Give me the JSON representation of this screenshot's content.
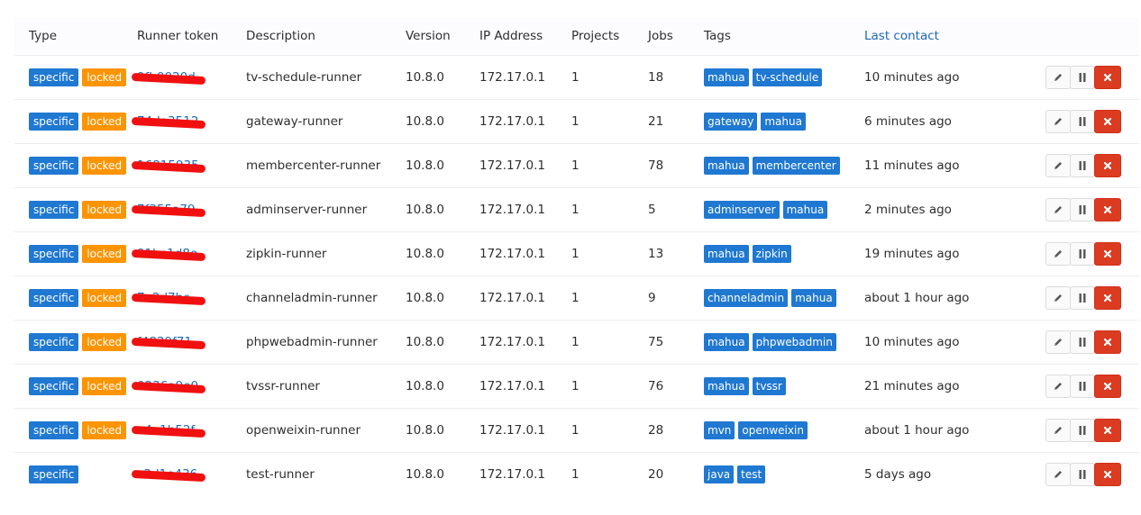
{
  "columns": {
    "type": "Type",
    "token": "Runner token",
    "description": "Description",
    "version": "Version",
    "ip": "IP Address",
    "projects": "Projects",
    "jobs": "Jobs",
    "tags": "Tags",
    "last_contact": "Last contact"
  },
  "runners": [
    {
      "specific": "specific",
      "locked": "locked",
      "token": "9fb0020d",
      "description": "tv-schedule-runner",
      "version": "10.8.0",
      "ip": "172.17.0.1",
      "projects": "1",
      "jobs": "18",
      "tags": [
        "mahua",
        "tv-schedule"
      ],
      "last_contact": "10 minutes ago"
    },
    {
      "specific": "specific",
      "locked": "locked",
      "token": "74de3512",
      "description": "gateway-runner",
      "version": "10.8.0",
      "ip": "172.17.0.1",
      "projects": "1",
      "jobs": "21",
      "tags": [
        "gateway",
        "mahua"
      ],
      "last_contact": "6 minutes ago"
    },
    {
      "specific": "specific",
      "locked": "locked",
      "token": "16815935",
      "description": "membercenter-runner",
      "version": "10.8.0",
      "ip": "172.17.0.1",
      "projects": "1",
      "jobs": "78",
      "tags": [
        "mahua",
        "membercenter"
      ],
      "last_contact": "11 minutes ago"
    },
    {
      "specific": "specific",
      "locked": "locked",
      "token": "7f355a79",
      "description": "adminserver-runner",
      "version": "10.8.0",
      "ip": "172.17.0.1",
      "projects": "1",
      "jobs": "5",
      "tags": [
        "adminserver",
        "mahua"
      ],
      "last_contact": "2 minutes ago"
    },
    {
      "specific": "specific",
      "locked": "locked",
      "token": "91bc1d8e",
      "description": "zipkin-runner",
      "version": "10.8.0",
      "ip": "172.17.0.1",
      "projects": "1",
      "jobs": "13",
      "tags": [
        "mahua",
        "zipkin"
      ],
      "last_contact": "19 minutes ago"
    },
    {
      "specific": "specific",
      "locked": "locked",
      "token": "7a2d7bc",
      "description": "channeladmin-runner",
      "version": "10.8.0",
      "ip": "172.17.0.1",
      "projects": "1",
      "jobs": "9",
      "tags": [
        "channeladmin",
        "mahua"
      ],
      "last_contact": "about 1 hour ago"
    },
    {
      "specific": "specific",
      "locked": "locked",
      "token": "f4839f71",
      "description": "phpwebadmin-runner",
      "version": "10.8.0",
      "ip": "172.17.0.1",
      "projects": "1",
      "jobs": "75",
      "tags": [
        "mahua",
        "phpwebadmin"
      ],
      "last_contact": "10 minutes ago"
    },
    {
      "specific": "specific",
      "locked": "locked",
      "token": "0236a9e0",
      "description": "tvssr-runner",
      "version": "10.8.0",
      "ip": "172.17.0.1",
      "projects": "1",
      "jobs": "76",
      "tags": [
        "mahua",
        "tvssr"
      ],
      "last_contact": "21 minutes ago"
    },
    {
      "specific": "specific",
      "locked": "locked",
      "token": "e4a1b52f",
      "description": "openweixin-runner",
      "version": "10.8.0",
      "ip": "172.17.0.1",
      "projects": "1",
      "jobs": "28",
      "tags": [
        "mvn",
        "openweixin"
      ],
      "last_contact": "about 1 hour ago"
    },
    {
      "specific": "specific",
      "locked": "",
      "token": "c3d1e436",
      "description": "test-runner",
      "version": "10.8.0",
      "ip": "172.17.0.1",
      "projects": "1",
      "jobs": "20",
      "tags": [
        "java",
        "test"
      ],
      "last_contact": "5 days ago"
    }
  ],
  "actions": {
    "edit_icon": "pencil-icon",
    "pause_icon": "pause-icon",
    "delete_icon": "close-icon"
  },
  "colors": {
    "specific": "#1f78d1",
    "locked": "#fc9403",
    "tag": "#1f78d1",
    "delete": "#db3b21",
    "link": "#1b69b6",
    "redaction": "#f01010"
  }
}
